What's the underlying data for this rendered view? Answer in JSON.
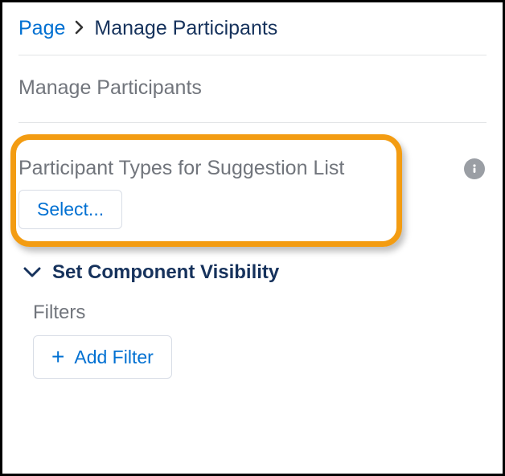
{
  "breadcrumb": {
    "root": "Page",
    "current": "Manage Participants"
  },
  "section": {
    "title": "Manage Participants"
  },
  "participantTypes": {
    "label": "Participant Types for Suggestion List",
    "selectLabel": "Select..."
  },
  "visibility": {
    "heading": "Set Component Visibility",
    "filtersLabel": "Filters",
    "addFilterLabel": "Add Filter"
  }
}
